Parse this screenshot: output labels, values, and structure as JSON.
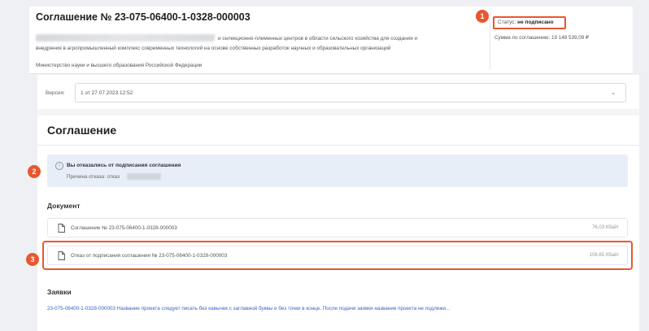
{
  "header": {
    "title": "Соглашение № 23-075-06400-1-0328-000003",
    "description_line1": "и селекционно-племенных центров в области сельского хозяйства для создания и",
    "description_line2": "внедрения в агропромышленный комплекс современных технологий на основе собственных разработок научных и образовательных организаций",
    "ministry": "Министерство науки и высшего образования Российской Федерации",
    "status_label": "Статус:",
    "status_value": "не подписано",
    "amount": "Сумма по соглашению: 19 148 539,09 ₽"
  },
  "badges": [
    "1",
    "2",
    "3"
  ],
  "version": {
    "label": "Версия:",
    "value": "1 от 27.07.2023 12:52",
    "chevron_icon": "chevron-down-icon"
  },
  "agreement": {
    "heading": "Соглашение",
    "notice_title": "Вы отказались от подписания соглашения",
    "notice_reason": "Причина отказа: отказ"
  },
  "documents": {
    "heading": "Документ",
    "items": [
      {
        "name": "Соглашение № 23-075-06400-1-0328-000003",
        "size": "76.03 Кбайт"
      },
      {
        "name": "Отказ от подписания соглашения № 23-075-06400-1-0328-000003",
        "size": "108.65 Кбайт"
      }
    ]
  },
  "applications": {
    "heading": "Заявки",
    "link_text": "23-075-06400-1-0328-000003 Название проекта следует писать без кавычек с заглавной буквы и без точки в конце. После подачи заявки название проекта не подлежи..."
  },
  "colors": {
    "accent": "#e8572f",
    "link": "#3b64c4",
    "notice_bg": "#e8eef7"
  }
}
